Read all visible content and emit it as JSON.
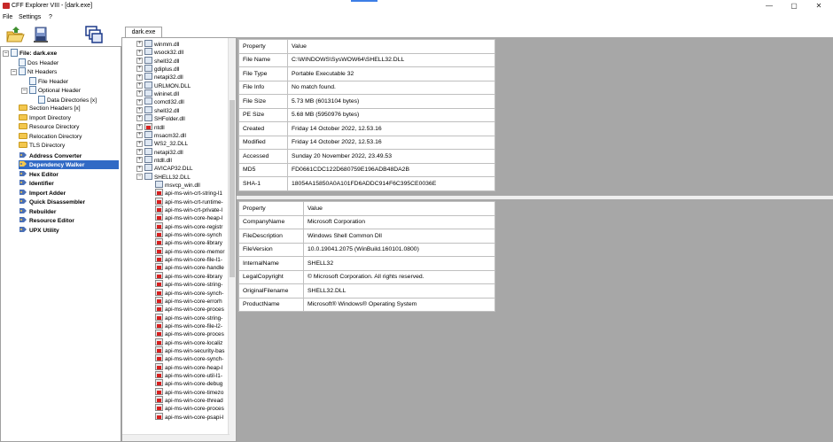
{
  "window": {
    "title": "CFF Explorer VIII - [dark.exe]",
    "controls": [
      "—",
      "▢",
      "✕"
    ]
  },
  "menu": [
    "File",
    "Settings",
    "?"
  ],
  "tab": {
    "label": "dark.exe"
  },
  "left_tree": {
    "root": "File: dark.exe",
    "items": [
      {
        "label": "Dos Header",
        "icon": "doc-icon"
      },
      {
        "label": "Nt Headers",
        "icon": "doc-icon"
      },
      {
        "label": "File Header",
        "icon": "doc-icon"
      },
      {
        "label": "Optional Header",
        "icon": "doc-icon"
      },
      {
        "label": "Data Directories [x]",
        "icon": "doc-icon"
      },
      {
        "label": "Section Headers [x]",
        "icon": "folder-icon"
      },
      {
        "label": "Import Directory",
        "icon": "folder-icon"
      },
      {
        "label": "Resource Directory",
        "icon": "folder-icon"
      },
      {
        "label": "Relocation Directory",
        "icon": "folder-icon"
      },
      {
        "label": "TLS Directory",
        "icon": "folder-icon"
      },
      {
        "label": "Address Converter",
        "icon": "tool-icon"
      },
      {
        "label": "Dependency Walker",
        "icon": "tool-icon"
      },
      {
        "label": "Hex Editor",
        "icon": "tool-icon"
      },
      {
        "label": "Identifier",
        "icon": "tool-icon"
      },
      {
        "label": "Import Adder",
        "icon": "tool-icon"
      },
      {
        "label": "Quick Disassembler",
        "icon": "tool-icon"
      },
      {
        "label": "Rebuilder",
        "icon": "tool-icon"
      },
      {
        "label": "Resource Editor",
        "icon": "tool-icon"
      },
      {
        "label": "UPX Utility",
        "icon": "tool-icon"
      }
    ]
  },
  "dependency_tree": {
    "top_modules": [
      "winmm.dll",
      "wsock32.dll",
      "shell32.dll",
      "gdiplus.dll",
      "netapi32.dll",
      "URLMON.DLL",
      "wininet.dll",
      "comctl32.dll",
      "shell32.dll",
      "SHFolder.dll",
      "ntdll",
      "msacm32.dll",
      "WS2_32.DLL",
      "netapi32.dll",
      "ntdll.dll",
      "AVICAP32.DLL",
      "SHELL32.DLL"
    ],
    "children": [
      "msvcp_win.dll",
      "api-ms-win-crt-string-l1",
      "api-ms-win-crt-runtime-",
      "api-ms-win-crt-private-l",
      "api-ms-win-core-heap-l",
      "api-ms-win-core-registr",
      "api-ms-win-core-synch",
      "api-ms-win-core-library",
      "api-ms-win-core-memor",
      "api-ms-win-core-file-l1-",
      "api-ms-win-core-handle",
      "api-ms-win-core-library",
      "api-ms-win-core-string-",
      "api-ms-win-core-synch-",
      "api-ms-win-core-errorh",
      "api-ms-win-core-proces",
      "api-ms-win-core-string-",
      "api-ms-win-core-file-l2-",
      "api-ms-win-core-proces",
      "api-ms-win-core-localiz",
      "api-ms-win-security-bas",
      "api-ms-win-core-synch-",
      "api-ms-win-core-heap-l",
      "api-ms-win-core-util-l1-",
      "api-ms-win-core-debug",
      "api-ms-win-core-timezo",
      "api-ms-win-core-thread",
      "api-ms-win-core-proces",
      "api-ms-win-core-psapi-l"
    ]
  },
  "file_info_table": {
    "headers": [
      "Property",
      "Value"
    ],
    "rows": [
      [
        "File Name",
        "C:\\WINDOWS\\SysWOW64\\SHELL32.DLL"
      ],
      [
        "File Type",
        "Portable Executable 32"
      ],
      [
        "File Info",
        "No match found."
      ],
      [
        "File Size",
        "5.73 MB (6013104 bytes)"
      ],
      [
        "PE Size",
        "5.68 MB (5950976 bytes)"
      ],
      [
        "Created",
        "Friday 14 October 2022, 12.53.16"
      ],
      [
        "Modified",
        "Friday 14 October 2022, 12.53.16"
      ],
      [
        "Accessed",
        "Sunday 20 November 2022, 23.49.53"
      ],
      [
        "MD5",
        "FD0661CDC122D680759E196ADB48DA2B"
      ],
      [
        "SHA-1",
        "18054A15850A0A101FD6ADDC914F6C395CE0036E"
      ]
    ]
  },
  "version_table": {
    "headers": [
      "Property",
      "Value"
    ],
    "rows": [
      [
        "CompanyName",
        "Microsoft Corporation"
      ],
      [
        "FileDescription",
        "Windows Shell Common Dll"
      ],
      [
        "FileVersion",
        "10.0.19041.2075 (WinBuild.160101.0800)"
      ],
      [
        "InternalName",
        "SHELL32"
      ],
      [
        "LegalCopyright",
        "© Microsoft Corporation. All rights reserved."
      ],
      [
        "OriginalFilename",
        "SHELL32.DLL"
      ],
      [
        "ProductName",
        "Microsoft® Windows® Operating System"
      ]
    ]
  },
  "colors": {
    "selection": "#316ac5",
    "panel_bg": "#a7a7a7"
  }
}
